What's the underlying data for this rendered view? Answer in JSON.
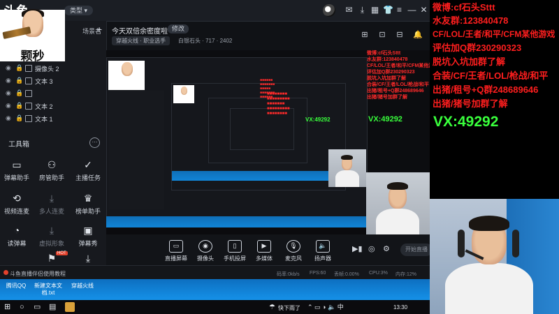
{
  "app": {
    "logo": "斗鱼",
    "live_type": "类型"
  },
  "stream": {
    "title": "今天双倍余密度啦~",
    "edit": "修改",
    "category": "穿越火线 · 职业选手",
    "meta": "白银石头 · 717 · 2402"
  },
  "overlay": {
    "avatar_text": "颗秒"
  },
  "scenes": {
    "label": "场景名",
    "add": "+"
  },
  "sources": [
    {
      "label": "摄像头 2"
    },
    {
      "label": "文本 3"
    },
    {
      "label": ""
    },
    {
      "label": "文本 2"
    },
    {
      "label": "文本 1"
    }
  ],
  "toolbox": {
    "title": "工具箱",
    "more": "···",
    "tools": [
      {
        "label": "弹幕助手",
        "icon": "▭",
        "dim": false
      },
      {
        "label": "房管助手",
        "icon": "⚇",
        "dim": false
      },
      {
        "label": "主播任务",
        "icon": "✓",
        "dim": false
      },
      {
        "label": "视频连麦",
        "icon": "⟲",
        "dim": false
      },
      {
        "label": "多人连麦",
        "icon": "⤓",
        "dim": true
      },
      {
        "label": "榜单助手",
        "icon": "♛",
        "dim": false
      },
      {
        "label": "读弹幕",
        "icon": "◔",
        "dim": false
      },
      {
        "label": "虚拟形象",
        "icon": "⤓",
        "dim": true
      },
      {
        "label": "弹幕秀",
        "icon": "▣",
        "dim": false
      },
      {
        "label": "",
        "icon": "⚑",
        "dim": false
      },
      {
        "label": "",
        "icon": "⤓",
        "dim": false
      }
    ]
  },
  "controls": [
    {
      "label": "直播屏幕",
      "icon": "▭"
    },
    {
      "label": "摄像头",
      "icon": "◉"
    },
    {
      "label": "手机投屏",
      "icon": "▯"
    },
    {
      "label": "多媒体",
      "icon": "▶"
    },
    {
      "label": "麦克风",
      "icon": "🎙"
    },
    {
      "label": "扬声器",
      "icon": "🔈"
    }
  ],
  "start_button": "开始直播",
  "status": {
    "notice": "斗鱼直播伴侣使用教程",
    "bitrate": "码率:0kb/s",
    "fps": "FPS:60",
    "dropped": "丢帧:0.00%",
    "cpu": "CPU:3%",
    "mem": "内存:12%"
  },
  "desktop_items": [
    "腾讯QQ",
    "新建文本文档.txt",
    "穿越火线"
  ],
  "taskbar": {
    "weather": "快下雨了",
    "time": "13:30"
  },
  "right_overlay": {
    "lines": [
      "微博:cf石头Sttt",
      "水友群:123840478",
      "CF/LOL/王者/和平/CFM某他游戏",
      "评估加Q群230290323",
      "脱坑入坑加群了解",
      "合装/CF/王者/LOL/枪战/和平",
      "出猪/租号+Q群248689646",
      "出猪/猪号加群了解"
    ],
    "vx": "VX:49292",
    "vx_mid": "VX:49292",
    "vx_small": "VX:49292"
  },
  "colors": {
    "overlay_red": "#ff1e1e",
    "overlay_green": "#39ff3c",
    "desktop_blue": "#1184d6",
    "panel_bg": "#17191e"
  }
}
